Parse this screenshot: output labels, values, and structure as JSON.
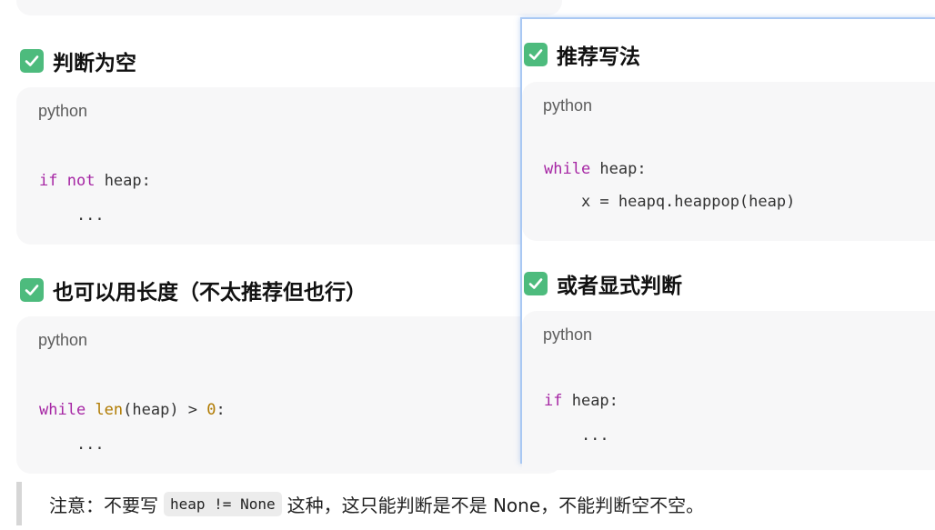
{
  "sections": {
    "empty_check": {
      "heading": "判断为空",
      "lang": "python",
      "code": [
        [
          {
            "t": "if",
            "c": "kw"
          },
          {
            "t": " "
          },
          {
            "t": "not",
            "c": "kw"
          },
          {
            "t": " heap:"
          }
        ],
        [
          {
            "t": "    ..."
          }
        ]
      ]
    },
    "length_check": {
      "heading": "也可以用长度（不太推荐但也行）",
      "lang": "python",
      "code": [
        [
          {
            "t": "while",
            "c": "kw"
          },
          {
            "t": " "
          },
          {
            "t": "len",
            "c": "bi"
          },
          {
            "t": "(heap) > "
          },
          {
            "t": "0",
            "c": "num"
          },
          {
            "t": ":"
          }
        ],
        [
          {
            "t": "    ..."
          }
        ]
      ]
    },
    "recommended": {
      "heading": "推荐写法",
      "lang": "python",
      "code": [
        [
          {
            "t": "while",
            "c": "kw"
          },
          {
            "t": " heap:"
          }
        ],
        [
          {
            "t": "    x = heapq.heappop(heap)"
          }
        ]
      ]
    },
    "explicit": {
      "heading": "或者显式判断",
      "lang": "python",
      "code": [
        [
          {
            "t": "if",
            "c": "kw"
          },
          {
            "t": " heap:"
          }
        ],
        [
          {
            "t": "    ..."
          }
        ]
      ]
    }
  },
  "note": {
    "prefix": "注意：不要写",
    "code": "heap != None",
    "suffix": "这种，这只能判断是不是 None，不能判断空不空。"
  },
  "colors": {
    "keyword": "#a626a4",
    "builtin": "#b07a00",
    "check": "#4dbb7d",
    "overlay_border": "#a9c8f3"
  },
  "icons": {
    "check": "check-mark-button-icon"
  }
}
